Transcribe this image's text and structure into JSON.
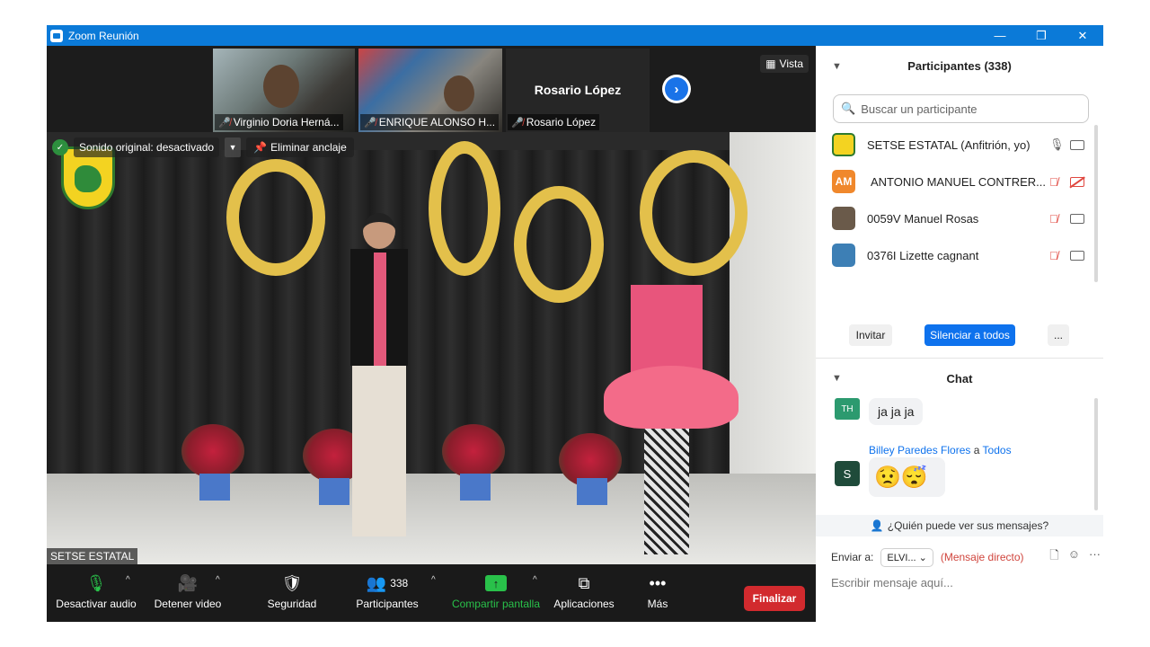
{
  "window": {
    "title": "Zoom Reunión",
    "buttons": [
      "—",
      "❐",
      "✕"
    ]
  },
  "thumbnails": [
    {
      "name": "Virginio Doria Herná..."
    },
    {
      "name": "ENRIQUE ALONSO H..."
    },
    {
      "name": "Rosario López",
      "big_name": "Rosario López"
    }
  ],
  "view_label": "Vista",
  "video_overlay": {
    "sound_label": "Sonido original: desactivado",
    "unpin_label": "Eliminar anclaje",
    "self_name": "SETSE ESTATAL"
  },
  "toolbar": {
    "audio": "Desactivar audio",
    "video": "Detener video",
    "security": "Seguridad",
    "participants": "Participantes",
    "participants_count": "338",
    "share": "Compartir pantalla",
    "apps": "Aplicaciones",
    "more": "Más",
    "end": "Finalizar"
  },
  "participants_panel": {
    "title": "Participantes (338)",
    "search_placeholder": "Buscar un participante",
    "items": [
      {
        "name": "SETSE ESTATAL (Anfitrión, yo)",
        "mic_muted": false,
        "cam_off": false
      },
      {
        "name": "ANTONIO MANUEL CONTRER...",
        "initials": "AM",
        "mic_muted": true,
        "cam_off": true
      },
      {
        "name": "0059V Manuel Rosas",
        "mic_muted": true,
        "cam_off": false
      },
      {
        "name": "0376I Lizette cagnant",
        "mic_muted": true,
        "cam_off": false
      }
    ],
    "invite": "Invitar",
    "mute_all": "Silenciar a todos",
    "more": "..."
  },
  "chat": {
    "title": "Chat",
    "messages": [
      {
        "avatar": "TH",
        "text": "ja ja ja"
      },
      {
        "avatar": "S",
        "sender": "Billey Paredes Flores",
        "connector": "a",
        "to": "Todos",
        "text": "😟😴"
      }
    ],
    "who_can_see": "¿Quién puede ver sus mensajes?",
    "send_to_label": "Enviar a:",
    "recipient": "ELVI...",
    "direct_label": "(Mensaje directo)",
    "compose_placeholder": "Escribir mensaje aquí..."
  },
  "colors": {
    "titlebar": "#0b7ad8",
    "end_button": "#d22a2e",
    "primary": "#0e72ed",
    "share": "#29c14a"
  }
}
